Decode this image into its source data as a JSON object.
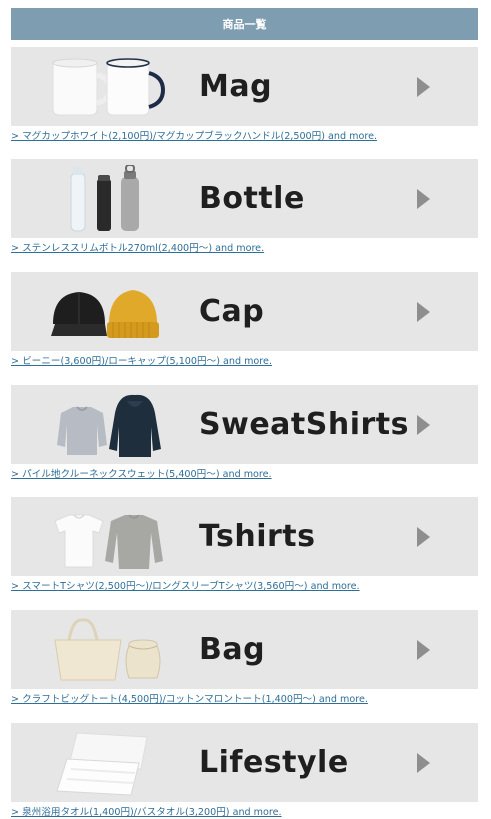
{
  "header": {
    "title": "商品一覧"
  },
  "items": [
    {
      "title": "Mag",
      "link": "> マグカップホワイト(2,100円)/マグカップブラックハンドル(2,500円) and more."
    },
    {
      "title": "Bottle",
      "link": "> ステンレススリムボトル270ml(2,400円～) and more."
    },
    {
      "title": "Cap",
      "link": "> ビーニー(3,600円)/ローキャップ(5,100円～) and more."
    },
    {
      "title": "SweatShirts",
      "link": "> パイル地クルーネックスウェット(5,400円～) and more."
    },
    {
      "title": "Tshirts",
      "link": "> スマートTシャツ(2,500円～)/ロングスリーブTシャツ(3,560円～) and more."
    },
    {
      "title": "Bag",
      "link": "> クラフトビッグトート(4,500円)/コットンマロントート(1,400円～) and more."
    },
    {
      "title": "Lifestyle",
      "link": "> 泉州浴用タオル(1,400円)/バスタオル(3,200円) and more."
    }
  ]
}
